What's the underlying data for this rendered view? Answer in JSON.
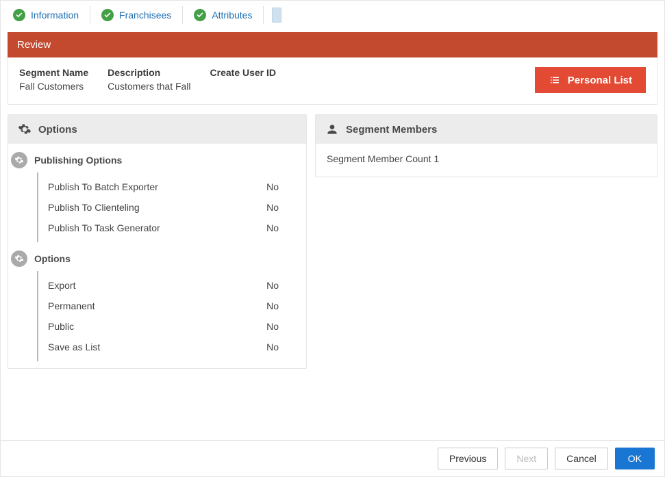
{
  "tabs": {
    "information": "Information",
    "franchisees": "Franchisees",
    "attributes": "Attributes"
  },
  "review": {
    "title": "Review"
  },
  "summary": {
    "segment_name_label": "Segment Name",
    "segment_name_value": "Fall Customers",
    "description_label": "Description",
    "description_value": "Customers that Fall",
    "create_user_id_label": "Create User ID",
    "create_user_id_value": "",
    "personal_list_label": "Personal List"
  },
  "options_panel": {
    "title": "Options",
    "groups": [
      {
        "title": "Publishing Options",
        "items": [
          {
            "label": "Publish To Batch Exporter",
            "value": "No"
          },
          {
            "label": "Publish To Clienteling",
            "value": "No"
          },
          {
            "label": "Publish To Task Generator",
            "value": "No"
          }
        ]
      },
      {
        "title": "Options",
        "items": [
          {
            "label": "Export",
            "value": "No"
          },
          {
            "label": "Permanent",
            "value": "No"
          },
          {
            "label": "Public",
            "value": "No"
          },
          {
            "label": "Save as List",
            "value": "No"
          }
        ]
      }
    ]
  },
  "members_panel": {
    "title": "Segment Members",
    "count_text": "Segment Member Count 1"
  },
  "footer": {
    "previous": "Previous",
    "next": "Next",
    "cancel": "Cancel",
    "ok": "OK"
  }
}
